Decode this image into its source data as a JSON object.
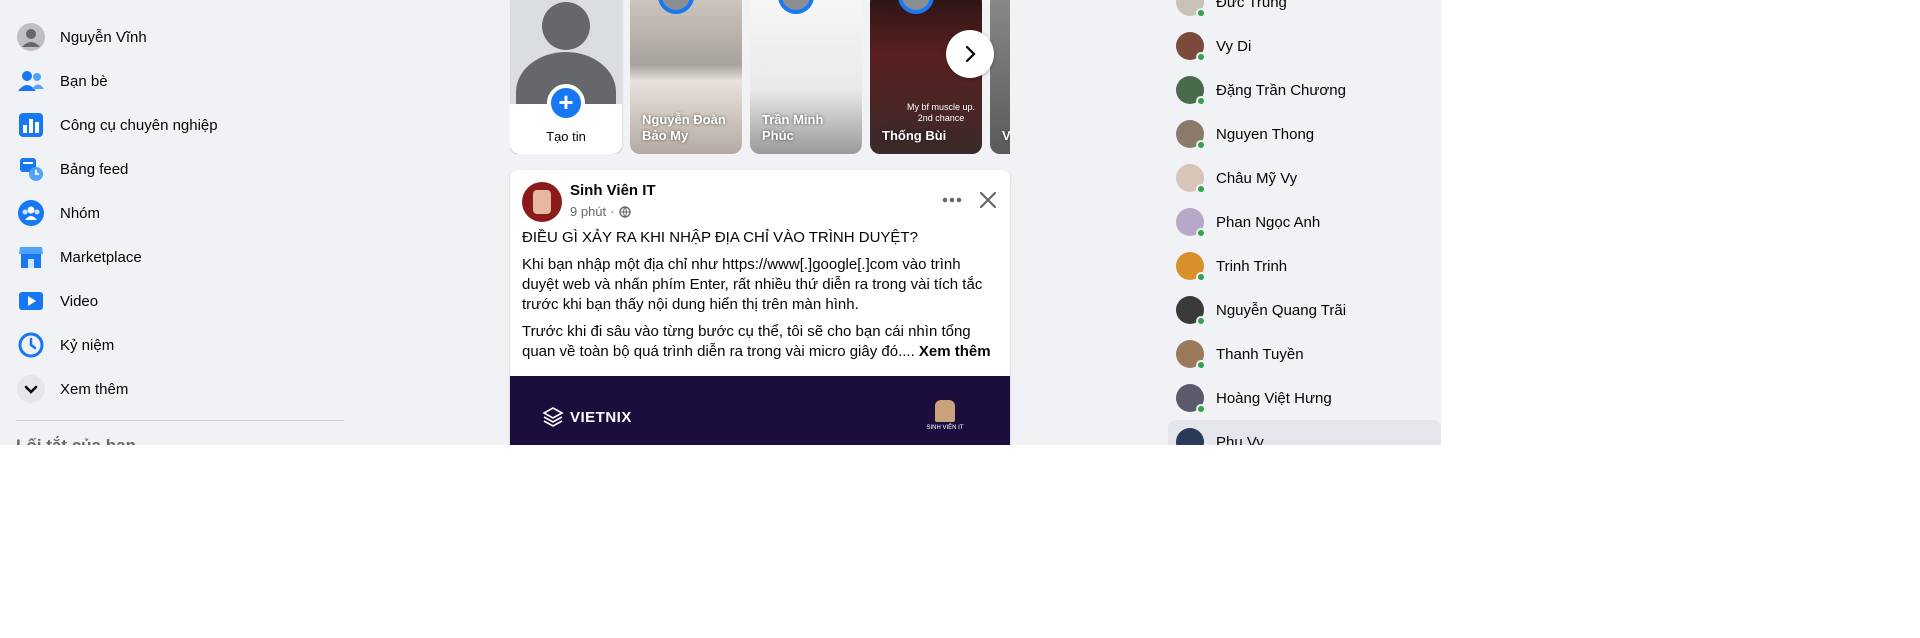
{
  "left_nav": {
    "items": [
      {
        "label": "Nguyễn Vĩnh",
        "icon": "profile-avatar-icon"
      },
      {
        "label": "Bạn bè",
        "icon": "friends-icon"
      },
      {
        "label": "Công cụ chuyên nghiệp",
        "icon": "professional-tools-icon"
      },
      {
        "label": "Bảng feed",
        "icon": "feeds-icon"
      },
      {
        "label": "Nhóm",
        "icon": "groups-icon"
      },
      {
        "label": "Marketplace",
        "icon": "marketplace-icon"
      },
      {
        "label": "Video",
        "icon": "video-icon"
      },
      {
        "label": "Kỷ niệm",
        "icon": "memories-icon"
      },
      {
        "label": "Xem thêm",
        "icon": "chevron-down-icon"
      }
    ],
    "shortcuts_heading": "Lối tắt của bạn"
  },
  "stories": {
    "create_label": "Tạo tin",
    "items": [
      {
        "name": "Nguyễn Đoàn Bảo My"
      },
      {
        "name": "Trần Minh Phúc"
      },
      {
        "name": "Thống Bùi",
        "overlay_text": "My bf muscle up. 2nd chance"
      },
      {
        "name": "V... C..."
      }
    ]
  },
  "post": {
    "author": "Sinh Viên IT",
    "time": "9 phút",
    "separator": "·",
    "paragraphs": [
      "ĐIỀU GÌ XẢY RA KHI NHẬP ĐỊA CHỈ VÀO TRÌNH DUYỆT?",
      "Khi bạn nhập một địa chỉ như https://www[.]google[.]com vào trình duyệt web và nhấn phím Enter, rất nhiều thứ diễn ra trong vài tích tắc trước khi bạn thấy nội dung hiển thị trên màn hình.",
      "Trước khi đi sâu vào từng bước cụ thể, tôi sẽ cho bạn cái nhìn tổng quan về toàn bộ quá trình diễn ra trong vài micro giây đó...."
    ],
    "see_more": "Xem thêm",
    "image_brand": "VIETNIX",
    "image_badge": "SINH VIÊN IT"
  },
  "contacts": [
    {
      "name": "Đức Trung",
      "color": "#c8c2b8"
    },
    {
      "name": "Vy Di",
      "color": "#7a4a3a"
    },
    {
      "name": "Đặng Trần Chương",
      "color": "#4a6b4a"
    },
    {
      "name": "Nguyen Thong",
      "color": "#8a7a6a"
    },
    {
      "name": "Châu Mỹ Vy",
      "color": "#d9c4b8"
    },
    {
      "name": "Phan Ngọc Anh",
      "color": "#b8a8c8"
    },
    {
      "name": "Trinh Trinh",
      "color": "#d9902a"
    },
    {
      "name": "Nguyễn Quang Trãi",
      "color": "#3a3a3a"
    },
    {
      "name": "Thanh Tuyền",
      "color": "#9a7a5a"
    },
    {
      "name": "Hoàng Việt Hưng",
      "color": "#5a5a6a"
    },
    {
      "name": "Phu Vy",
      "color": "#2a3a5a"
    }
  ],
  "colors": {
    "accent": "#1877f2",
    "background": "#f0f2f5",
    "online": "#31a24c"
  }
}
